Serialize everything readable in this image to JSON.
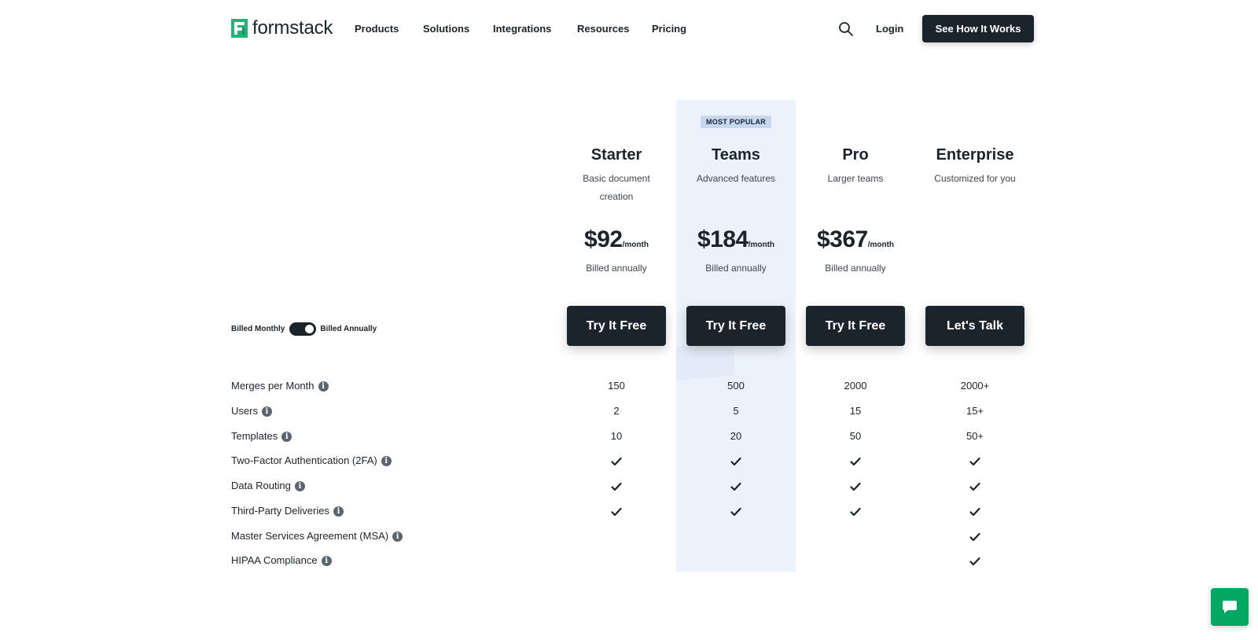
{
  "brand": {
    "name": "formstack",
    "logo_color": "#21b573"
  },
  "nav": {
    "items": [
      {
        "label": "Products"
      },
      {
        "label": "Solutions"
      },
      {
        "label": "Integrations"
      },
      {
        "label": "Resources"
      },
      {
        "label": "Pricing"
      }
    ],
    "search_icon": "search-icon",
    "login_label": "Login",
    "cta_label": "See How It Works"
  },
  "pricing": {
    "popular_badge": "MOST POPULAR",
    "plans": [
      {
        "name": "Starter",
        "desc": "Basic document creation",
        "price": "$92",
        "unit": "/month",
        "billed": "Billed annually",
        "button": "Try It Free"
      },
      {
        "name": "Teams",
        "desc": "Advanced features",
        "price": "$184",
        "unit": "/month",
        "billed": "Billed annually",
        "button": "Try It Free"
      },
      {
        "name": "Pro",
        "desc": "Larger teams",
        "price": "$367",
        "unit": "/month",
        "billed": "Billed annually",
        "button": "Try It Free"
      },
      {
        "name": "Enterprise",
        "desc": "Customized for you",
        "price": "",
        "unit": "",
        "billed": "",
        "button": "Let's Talk"
      }
    ],
    "toggle": {
      "left_label": "Billed Monthly",
      "right_label": "Billed Annually",
      "selected": "annually"
    },
    "highlight_color": "#ecf2fb",
    "features": [
      {
        "label": "Merges per Month",
        "values": [
          "150",
          "500",
          "2000",
          "2000+"
        ]
      },
      {
        "label": "Users",
        "values": [
          "2",
          "5",
          "15",
          "15+"
        ]
      },
      {
        "label": "Templates",
        "values": [
          "10",
          "20",
          "50",
          "50+"
        ]
      },
      {
        "label": "Two-Factor Authentication (2FA)",
        "values": [
          "check",
          "check",
          "check",
          "check"
        ]
      },
      {
        "label": "Data Routing",
        "values": [
          "check",
          "check",
          "check",
          "check"
        ]
      },
      {
        "label": "Third-Party Deliveries",
        "values": [
          "check",
          "check",
          "check",
          "check"
        ]
      },
      {
        "label": "Master Services Agreement (MSA)",
        "values": [
          "",
          "",
          "",
          "check"
        ]
      },
      {
        "label": "HIPAA Compliance",
        "values": [
          "",
          "",
          "",
          "check"
        ]
      }
    ]
  },
  "chat": {
    "icon": "chat-icon",
    "color": "#00a862"
  }
}
